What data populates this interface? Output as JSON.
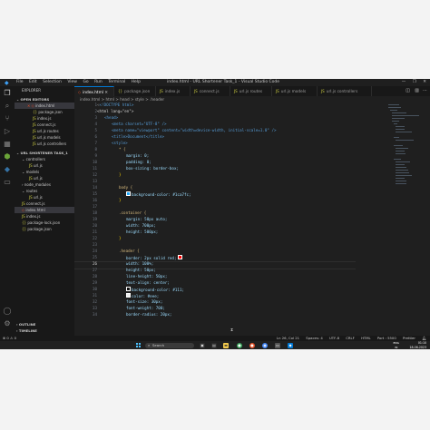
{
  "window": {
    "title": "index.html - URL Shortener Task_1 - Visual Studio Code",
    "menu": [
      "File",
      "Edit",
      "Selection",
      "View",
      "Go",
      "Run",
      "Terminal",
      "Help"
    ],
    "controls": [
      "—",
      "❐",
      "✕"
    ]
  },
  "sidebar": {
    "explorer_label": "EXPLORER",
    "open_editors_label": "OPEN EDITORS",
    "open_editors": [
      {
        "name": "index.html",
        "active": true
      },
      {
        "name": "package.json"
      },
      {
        "name": "index.js"
      },
      {
        "name": "connect.js"
      },
      {
        "name": "url.js  routes"
      },
      {
        "name": "url.js  models"
      },
      {
        "name": "url.js  controllers"
      }
    ],
    "project_label": "URL SHORTENER TASK_1",
    "tree": [
      {
        "name": "controllers",
        "type": "folder"
      },
      {
        "name": "url.js",
        "type": "file"
      },
      {
        "name": "models",
        "type": "folder"
      },
      {
        "name": "url.js",
        "type": "file"
      },
      {
        "name": "node_modules",
        "type": "folder"
      },
      {
        "name": "routes",
        "type": "folder"
      },
      {
        "name": "url.js",
        "type": "file"
      },
      {
        "name": "connect.js",
        "type": "file"
      },
      {
        "name": "index.html",
        "type": "file",
        "active": true
      },
      {
        "name": "index.js",
        "type": "file"
      },
      {
        "name": "package-lock.json",
        "type": "file"
      },
      {
        "name": "package.json",
        "type": "file"
      }
    ],
    "outline_label": "OUTLINE",
    "timeline_label": "TIMELINE"
  },
  "tabs": [
    {
      "label": "index.html",
      "active": true
    },
    {
      "label": "package.json"
    },
    {
      "label": "index.js"
    },
    {
      "label": "connect.js"
    },
    {
      "label": "url.js  routes"
    },
    {
      "label": "url.js  models"
    },
    {
      "label": "url.js  controllers"
    }
  ],
  "breadcrumb": "index.html > html > head > style > .header",
  "editor": {
    "current_line": 26,
    "lines": [
      {
        "n": 1,
        "text": "<!DOCTYPE html>"
      },
      {
        "n": 2,
        "text": "<html lang=\"en\">"
      },
      {
        "n": 3,
        "text": "<head>"
      },
      {
        "n": 4,
        "text": "<meta charset=\"UTF-8\" />"
      },
      {
        "n": 5,
        "text": "<meta name=\"viewport\" content=\"width=device-width, initial-scale=1.0\" />"
      },
      {
        "n": 6,
        "text": "<title>Document</title>"
      },
      {
        "n": 7,
        "text": "<style>"
      },
      {
        "n": 8,
        "text": "* {"
      },
      {
        "n": 9,
        "text": "margin: 0;"
      },
      {
        "n": 10,
        "text": "padding: 0;"
      },
      {
        "n": 11,
        "text": "box-sizing: border-box;"
      },
      {
        "n": 12,
        "text": "}"
      },
      {
        "n": 13,
        "text": ""
      },
      {
        "n": 14,
        "text": "body {"
      },
      {
        "n": 15,
        "text": "background-color: #1ca7fc;"
      },
      {
        "n": 16,
        "text": "}"
      },
      {
        "n": 17,
        "text": ""
      },
      {
        "n": 18,
        "text": ".container {"
      },
      {
        "n": 19,
        "text": "margin: 50px auto;"
      },
      {
        "n": 20,
        "text": "width: 700px;"
      },
      {
        "n": 21,
        "text": "height: 500px;"
      },
      {
        "n": 22,
        "text": "}"
      },
      {
        "n": 23,
        "text": ""
      },
      {
        "n": 24,
        "text": ".header {"
      },
      {
        "n": 25,
        "text": "border: 2px solid red;"
      },
      {
        "n": 26,
        "text": "width: 100%;"
      },
      {
        "n": 27,
        "text": "height: 50px;"
      },
      {
        "n": 28,
        "text": "line-height: 50px;"
      },
      {
        "n": 29,
        "text": "text-align: center;"
      },
      {
        "n": 30,
        "text": "background-color: #111;"
      },
      {
        "n": 31,
        "text": "color: #eee;"
      },
      {
        "n": 32,
        "text": "font-size: 30px;"
      },
      {
        "n": 33,
        "text": "font-weight: 700;"
      },
      {
        "n": 34,
        "text": "border-radius: 20px;"
      }
    ]
  },
  "statusbar": {
    "left": "⊗ 0 ⚠ 0",
    "items": [
      "Ln 26, Col 21",
      "Spaces: 4",
      "UTF-8",
      "CRLF",
      "HTML",
      "Port : 5500",
      "Prettier"
    ]
  },
  "taskbar": {
    "search_placeholder": "Search",
    "time": "01:10",
    "date": "18-06-2023",
    "lang": "ENG\nIN"
  },
  "colors": {
    "accent": "#0078d4",
    "editor_bg": "#1f1f1f",
    "sidebar_bg": "#181818"
  }
}
